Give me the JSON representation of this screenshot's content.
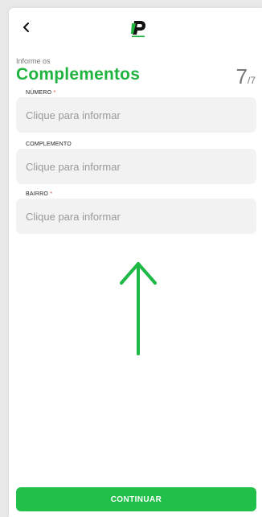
{
  "header": {
    "back_icon": "chevron-left-icon",
    "logo_icon": "brand-p-logo"
  },
  "intro": {
    "subtitle": "Informe os",
    "title": "Complementos",
    "step_current": "7",
    "step_total": "/7"
  },
  "form": {
    "fields": [
      {
        "label": "NÚMERO",
        "required_mark": "*",
        "placeholder": "Clique para informar"
      },
      {
        "label": "COMPLEMENTO",
        "required_mark": "",
        "placeholder": "Clique para informar"
      },
      {
        "label": "BAIRRO",
        "required_mark": "*",
        "placeholder": "Clique para informar"
      }
    ]
  },
  "hint": {
    "icon": "arrow-up-icon"
  },
  "footer": {
    "continue_label": "CONTINUAR"
  },
  "colors": {
    "brand_green": "#21b33f",
    "button_green": "#22c04a",
    "required_red": "#e23c3c"
  }
}
